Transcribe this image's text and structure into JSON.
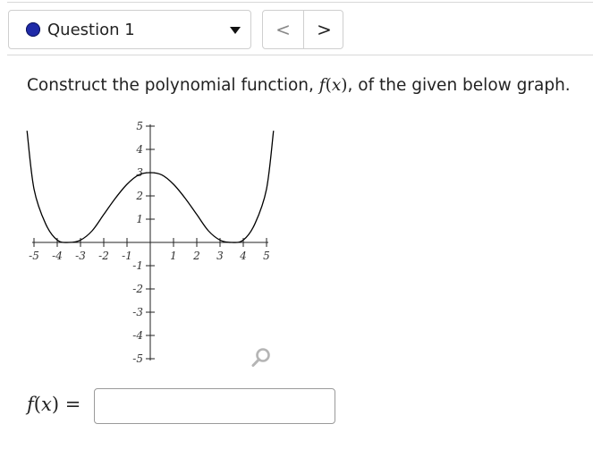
{
  "question_select": {
    "label": "Question 1",
    "status_color": "#1f2aa8"
  },
  "nav": {
    "prev_glyph": "<",
    "next_glyph": ">"
  },
  "prompt": {
    "before": "Construct the polynomial function, ",
    "func": "f",
    "open": "(",
    "var": "x",
    "close": ")",
    "after": ", of the given below graph."
  },
  "answer": {
    "func": "f",
    "open": "(",
    "var": "x",
    "close": ")",
    "equals": " = ",
    "value": ""
  },
  "chart_data": {
    "type": "line",
    "x_range": [
      -5,
      5
    ],
    "y_range": [
      -5,
      5
    ],
    "x_ticks": [
      -5,
      -4,
      -3,
      -2,
      -1,
      1,
      2,
      3,
      4,
      5
    ],
    "y_ticks": [
      -5,
      -4,
      -3,
      -2,
      -1,
      1,
      2,
      3,
      4,
      5
    ],
    "x_tick_labels": [
      "-5",
      "-4",
      "-3",
      "-2",
      "-1",
      "1",
      "2",
      "3",
      "4",
      "5"
    ],
    "y_tick_labels": [
      "-5",
      "-4",
      "-3",
      "-2",
      "-1",
      "1",
      "2",
      "3",
      "4",
      "5"
    ],
    "series": [
      {
        "x": [
          -5.3,
          -5,
          -4.5,
          -4,
          -3.5,
          -3,
          -2.5,
          -2,
          -1.5,
          -1,
          -0.5,
          0,
          0.5,
          1,
          1.5,
          2,
          2.5,
          3,
          3.5,
          4,
          4.5,
          5,
          5.3
        ],
        "y": [
          4.8,
          2.3,
          0.8,
          0.1,
          0,
          0.1,
          0.5,
          1.2,
          1.9,
          2.5,
          2.9,
          3,
          2.9,
          2.5,
          1.9,
          1.2,
          0.5,
          0.1,
          0,
          0.1,
          0.8,
          2.3,
          4.8
        ]
      }
    ],
    "grid": false,
    "line_color": "#000000"
  }
}
